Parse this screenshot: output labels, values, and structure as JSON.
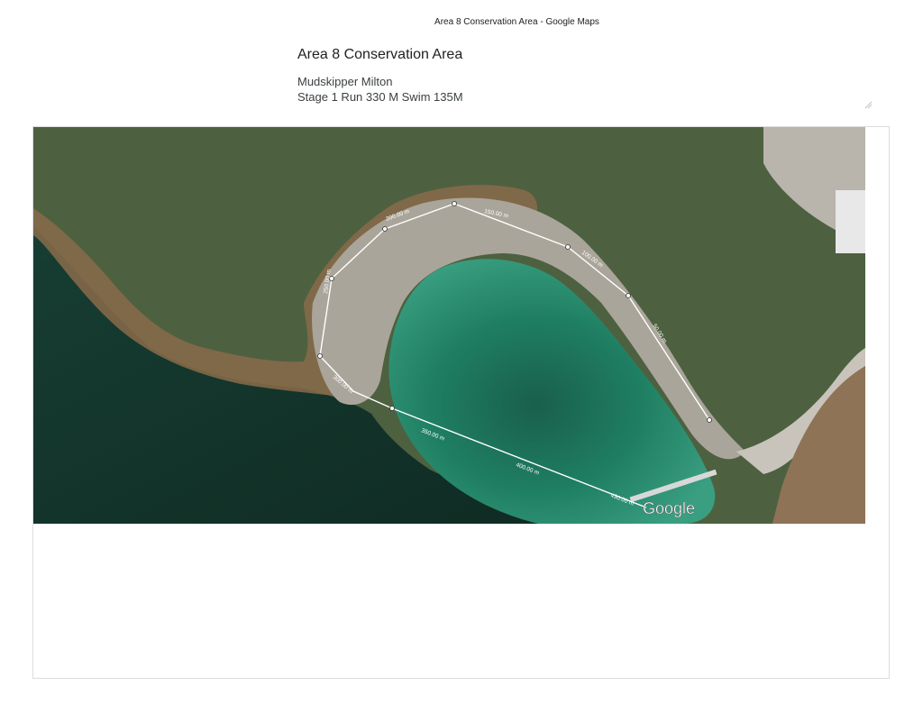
{
  "page_header": "Area 8 Conservation Area - Google Maps",
  "map_info": {
    "title": "Area 8 Conservation Area",
    "description_line1": "Mudskipper Milton",
    "description_line2": "Stage 1 Run 330 M Swim 135M"
  },
  "map": {
    "type": "satellite",
    "watermark": "Google",
    "distance_labels": [
      "200.00 m",
      "150.00 m",
      "100.00 m",
      "50.00 m",
      "250.00 m",
      "300.00 m",
      "350.00 m",
      "400.00 m",
      "430.00 m"
    ]
  },
  "colors": {
    "grass": "#4a5e3c",
    "water_deep": "#1a3a30",
    "lagoon": "#1e7a5e",
    "path": "#c9c4b8",
    "route": "#ffffff"
  }
}
